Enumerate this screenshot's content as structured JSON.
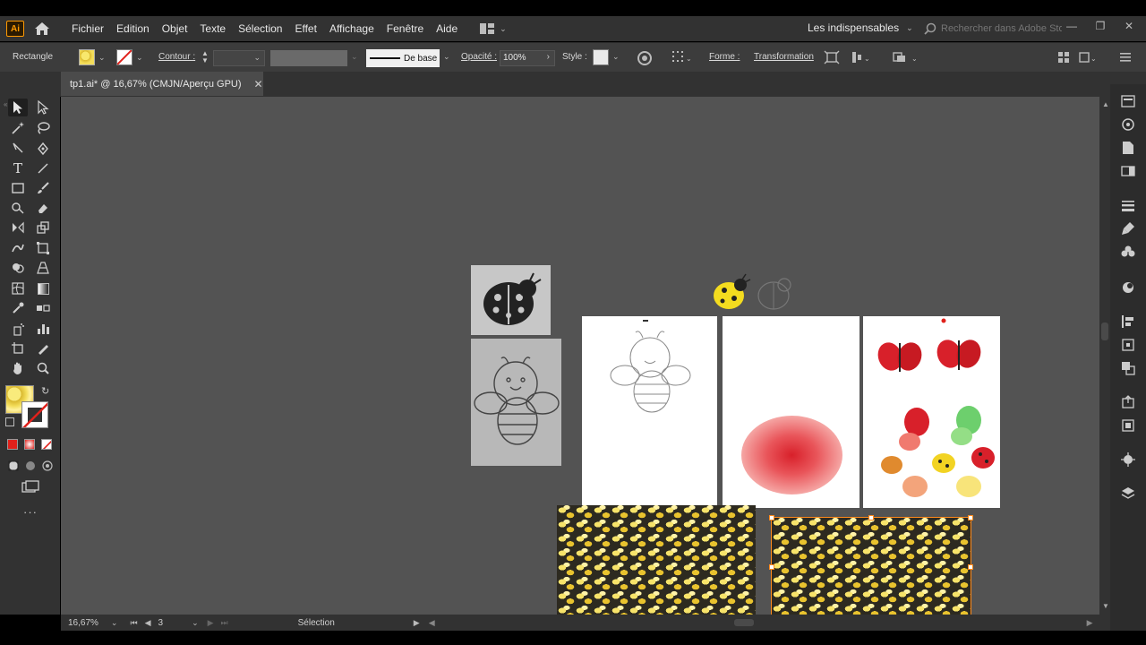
{
  "app": {
    "logo": "Ai",
    "menu": [
      "Fichier",
      "Edition",
      "Objet",
      "Texte",
      "Sélection",
      "Effet",
      "Affichage",
      "Fenêtre",
      "Aide"
    ],
    "workspace": "Les indispensables",
    "stock_search_placeholder": "Rechercher dans Adobe Stock"
  },
  "control": {
    "selection_type": "Rectangle",
    "stroke_label": "Contour :",
    "stroke_profile": "De base",
    "opacity_label": "Opacité :",
    "opacity_value": "100%",
    "style_label": "Style :",
    "shape_label": "Forme :",
    "transform_label": "Transformation"
  },
  "document": {
    "tab_title": "tp1.ai* @ 16,67% (CMJN/Aperçu GPU)"
  },
  "status": {
    "zoom": "16,67%",
    "artboard_number": "3",
    "tool_name": "Sélection"
  },
  "colors": {
    "accent": "#ff9a00",
    "ui_dark": "#323232",
    "canvas": "#535353",
    "ladybug_red": "#d8202a",
    "pattern_yellow": "#f1d84a"
  }
}
